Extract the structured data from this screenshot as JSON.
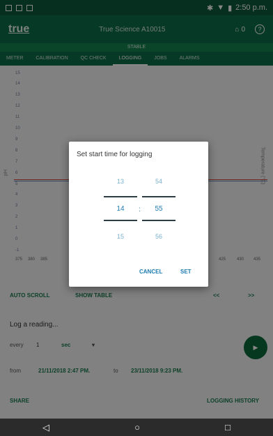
{
  "status": {
    "time": "2:50 p.m."
  },
  "app": {
    "logo": "true",
    "device_name": "True Science A10015",
    "basket_count": "0",
    "help_glyph": "?"
  },
  "stable_label": "STABLE",
  "tabs": [
    {
      "label": "METER"
    },
    {
      "label": "CALIBRATION"
    },
    {
      "label": "QC CHECK"
    },
    {
      "label": "LOGGING"
    },
    {
      "label": "JOBS"
    },
    {
      "label": "ALARMS"
    }
  ],
  "chart": {
    "y_ticks": [
      "15",
      "14",
      "13",
      "12",
      "11",
      "10",
      "9",
      "8",
      "7",
      "6",
      "5",
      "4",
      "3",
      "2",
      "1",
      "0",
      "-1"
    ],
    "y_axis_label": "pH",
    "y2_axis_label": "Temperature (°C)",
    "x_ticks": [
      "375",
      "380",
      "385",
      "425",
      "430",
      "435"
    ]
  },
  "controls": {
    "auto_scroll": "AUTO SCROLL",
    "show_table": "SHOW TABLE",
    "prev": "<<",
    "next": ">>",
    "log_prompt": "Log a reading...",
    "every_label": "every",
    "every_value": "1",
    "unit": "sec",
    "from_label": "from",
    "from_value": "21/11/2018 2:47 PM.",
    "to_label": "to",
    "to_value": "23/11/2018 9:23 PM.",
    "share": "SHARE",
    "logging_history": "LOGGING HISTORY"
  },
  "dialog": {
    "title": "Set start time for logging",
    "hour_prev": "13",
    "hour_sel": "14",
    "hour_next": "15",
    "min_prev": "54",
    "min_sel": "55",
    "min_next": "56",
    "separator": ":",
    "cancel": "CANCEL",
    "set": "SET"
  }
}
